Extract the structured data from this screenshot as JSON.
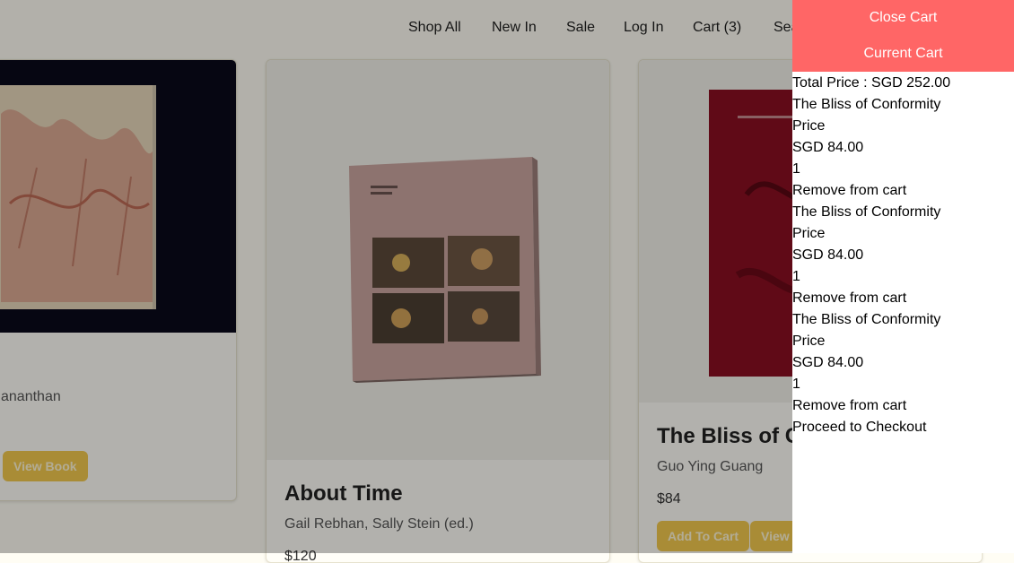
{
  "nav": {
    "links": [
      "Shop All",
      "New In",
      "Sale",
      "Log In",
      "Cart (3)",
      "Search"
    ]
  },
  "products": [
    {
      "title": "",
      "author": "ananthan",
      "view_label": "View Book"
    },
    {
      "title": "About Time",
      "author": "Gail Rebhan, Sally Stein (ed.)",
      "price": "$120"
    },
    {
      "title": "The Bliss of Conformity",
      "author": "Guo Ying Guang",
      "price": "$84",
      "add_label": "Add To Cart",
      "view_label": "View Book"
    }
  ],
  "cart": {
    "close_label": "Close Cart",
    "title_label": "Current Cart",
    "total": "Total Price : SGD 252.00",
    "items": [
      {
        "name": "The Bliss of Conformity",
        "price_label": "Price",
        "price": "SGD 84.00",
        "qty": "1",
        "remove_label": "Remove from cart"
      },
      {
        "name": "The Bliss of Conformity",
        "price_label": "Price",
        "price": "SGD 84.00",
        "qty": "1",
        "remove_label": "Remove from cart"
      },
      {
        "name": "The Bliss of Conformity",
        "price_label": "Price",
        "price": "SGD 84.00",
        "qty": "1",
        "remove_label": "Remove from cart"
      }
    ],
    "checkout_label": "Proceed to Checkout"
  },
  "colors": {
    "cart_button": "#ff6666",
    "accent_button": "#f3c94e",
    "overlay": "rgba(0,0,0,0.3)"
  }
}
